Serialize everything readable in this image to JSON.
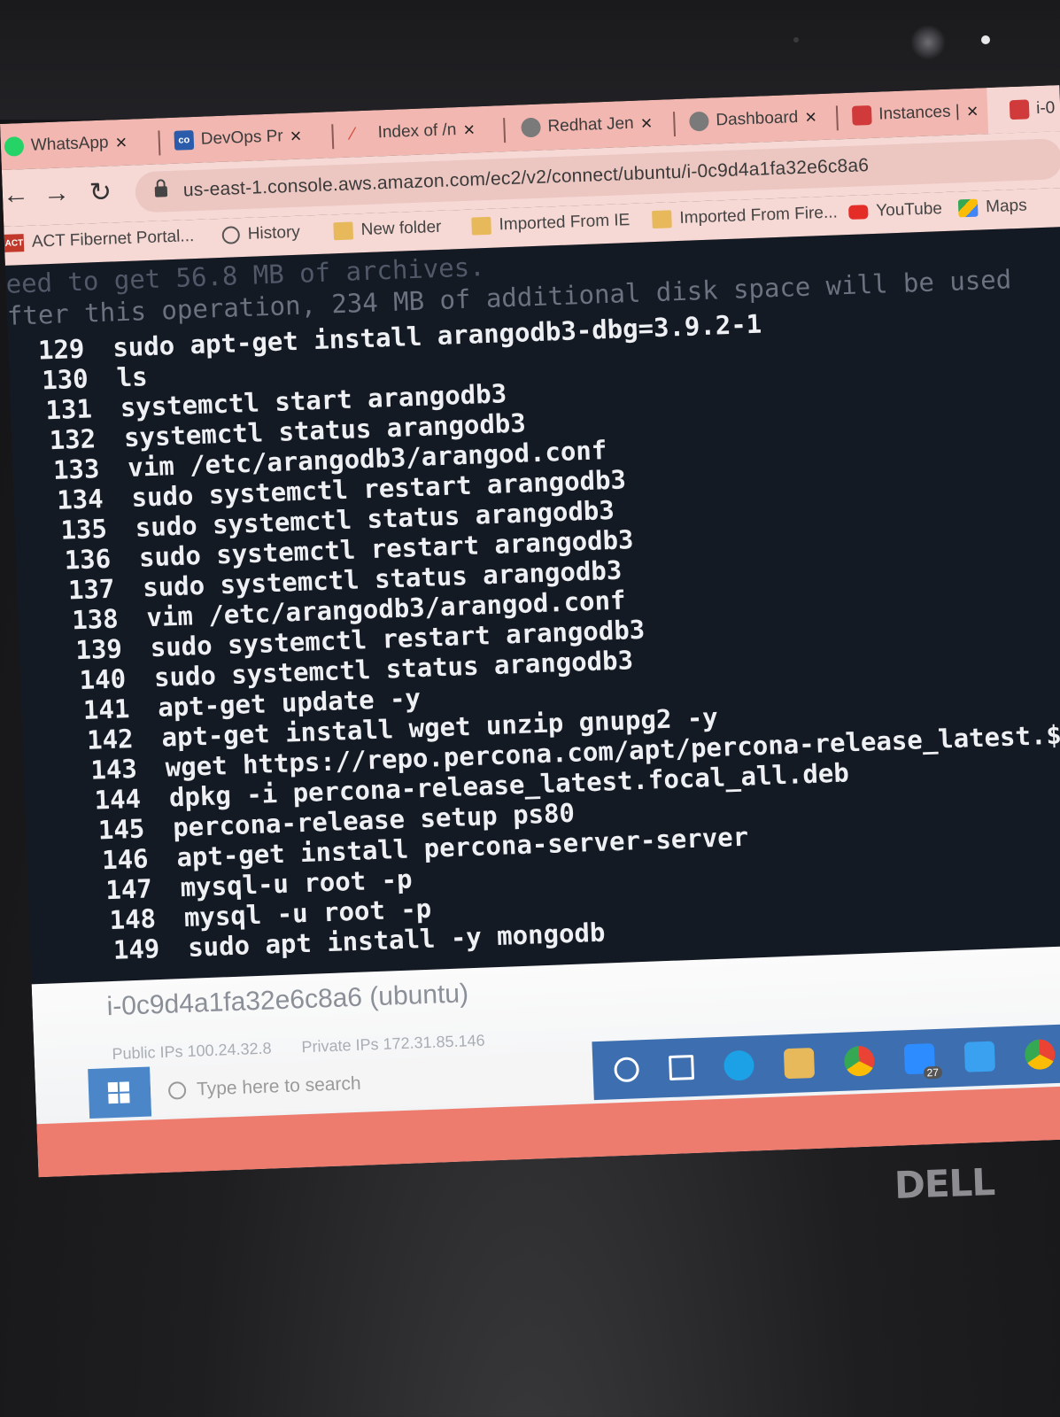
{
  "browser": {
    "tabs": [
      {
        "label": "WhatsApp",
        "icon": "whatsapp-icon",
        "color": "#25d366"
      },
      {
        "label": "DevOps Pr",
        "icon": "co-icon",
        "color": "#2b5cab"
      },
      {
        "label": "Index of /n",
        "icon": "index-icon",
        "color": "#d24b3a"
      },
      {
        "label": "Redhat Jen",
        "icon": "jenkins-icon",
        "color": "#5a5a5a"
      },
      {
        "label": "Dashboard",
        "icon": "jenkins-icon",
        "color": "#5a5a5a"
      },
      {
        "label": "Instances |",
        "icon": "aws-icon",
        "color": "#d13a3a"
      },
      {
        "label": "i-0",
        "icon": "aws-icon",
        "color": "#d13a3a"
      }
    ],
    "url": "us-east-1.console.aws.amazon.com/ec2/v2/connect/ubuntu/i-0c9d4a1fa32e6c8a6",
    "bookmarks": [
      {
        "label": "ACT Fibernet Portal...",
        "icon": "act-icon"
      },
      {
        "label": "History",
        "icon": "history-icon"
      },
      {
        "label": "New folder",
        "icon": "folder-icon"
      },
      {
        "label": "Imported From IE",
        "icon": "folder-icon"
      },
      {
        "label": "Imported From Fire...",
        "icon": "folder-icon"
      },
      {
        "label": "YouTube",
        "icon": "youtube-icon"
      },
      {
        "label": "Maps",
        "icon": "maps-icon"
      }
    ]
  },
  "terminal": {
    "pre_lines": [
      "eed to get 56.8 MB of archives.",
      "fter this operation, 234 MB of additional disk space will be used"
    ],
    "history": [
      {
        "n": "129",
        "cmd": "sudo apt-get install arangodb3-dbg=3.9.2-1"
      },
      {
        "n": "130",
        "cmd": "ls"
      },
      {
        "n": "131",
        "cmd": "systemctl start arangodb3"
      },
      {
        "n": "132",
        "cmd": "systemctl status arangodb3"
      },
      {
        "n": "133",
        "cmd": "vim /etc/arangodb3/arangod.conf"
      },
      {
        "n": "134",
        "cmd": "sudo systemctl restart arangodb3"
      },
      {
        "n": "135",
        "cmd": "sudo systemctl status arangodb3"
      },
      {
        "n": "136",
        "cmd": "sudo systemctl restart arangodb3"
      },
      {
        "n": "137",
        "cmd": "sudo systemctl status arangodb3"
      },
      {
        "n": "138",
        "cmd": "vim /etc/arangodb3/arangod.conf"
      },
      {
        "n": "139",
        "cmd": "sudo systemctl restart arangodb3"
      },
      {
        "n": "140",
        "cmd": "sudo systemctl status arangodb3"
      },
      {
        "n": "141",
        "cmd": "apt-get update -y"
      },
      {
        "n": "142",
        "cmd": "apt-get install wget unzip gnupg2 -y"
      },
      {
        "n": "143",
        "cmd": "wget https://repo.percona.com/apt/percona-release_latest.$(lsb_r"
      },
      {
        "n": "144",
        "cmd": "dpkg -i percona-release_latest.focal_all.deb"
      },
      {
        "n": "145",
        "cmd": "percona-release setup ps80"
      },
      {
        "n": "146",
        "cmd": "apt-get install percona-server-server"
      },
      {
        "n": "147",
        "cmd": "mysql-u root -p"
      },
      {
        "n": "148",
        "cmd": "mysql -u root -p"
      },
      {
        "n": "149",
        "cmd": "sudo apt install -y mongodb"
      }
    ]
  },
  "instance": {
    "name": "i-0c9d4a1fa32e6c8a6 (ubuntu)",
    "public_ips_label": "Public IPs",
    "public_ips_value": "100.24.32.8",
    "private_ips_label": "Private IPs",
    "private_ips_value": "172.31.85.146"
  },
  "taskbar": {
    "search_placeholder": "Type here to search",
    "badge": "27"
  },
  "laptop": {
    "brand": "DELL"
  },
  "colors": {
    "tab_bar": "#f1b7b0",
    "terminal_bg": "#141a24",
    "terminal_fg": "#eef0f3"
  }
}
